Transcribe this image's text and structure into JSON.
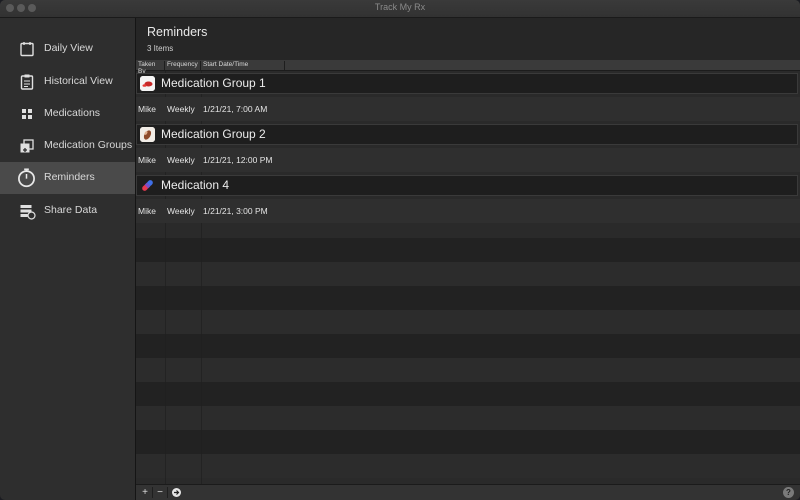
{
  "window": {
    "title": "Track My Rx"
  },
  "sidebar": {
    "items": [
      {
        "label": "Daily View",
        "icon": "calendar-icon"
      },
      {
        "label": "Historical View",
        "icon": "clipboard-icon"
      },
      {
        "label": "Medications",
        "icon": "grid-icon"
      },
      {
        "label": "Medication Groups",
        "icon": "stack-plus-icon"
      },
      {
        "label": "Reminders",
        "icon": "stopwatch-icon",
        "selected": true
      },
      {
        "label": "Share Data",
        "icon": "share-data-icon"
      }
    ]
  },
  "main": {
    "title": "Reminders",
    "count": "3 Items",
    "columns": [
      "Taken By",
      "Frequency",
      "Start Date/Time"
    ],
    "groups": [
      {
        "name": "Medication Group 1",
        "reminder": {
          "taken_by": "Mike",
          "frequency": "Weekly",
          "start": "1/21/21, 7:00 AM"
        }
      },
      {
        "name": "Medication Group 2",
        "reminder": {
          "taken_by": "Mike",
          "frequency": "Weekly",
          "start": "1/21/21, 12:00 PM"
        }
      },
      {
        "name": "Medication 4",
        "reminder": {
          "taken_by": "Mike",
          "frequency": "Weekly",
          "start": "1/21/21, 3:00 PM"
        }
      }
    ]
  },
  "bottombar": {
    "add_label": "+",
    "remove_label": "−",
    "help_label": "?"
  },
  "colors": {
    "selected_sidebar": "#4a4a4a",
    "background": "#262626"
  }
}
